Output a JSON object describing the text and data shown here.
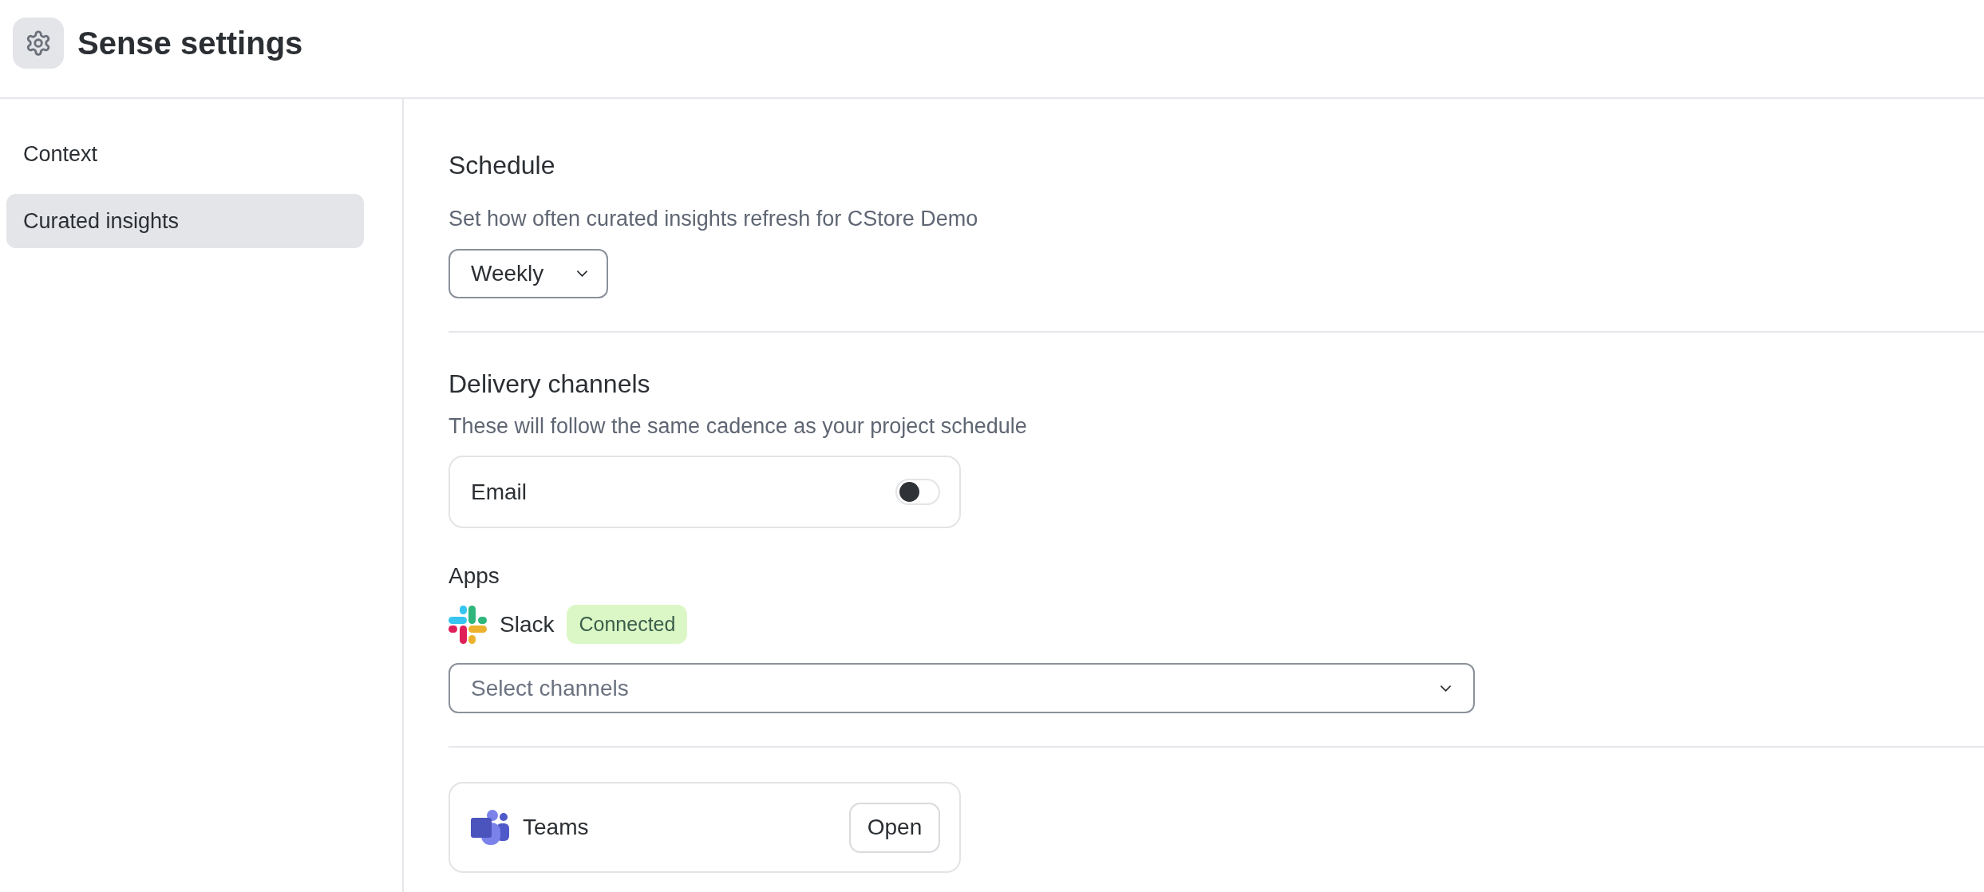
{
  "header": {
    "title": "Sense settings"
  },
  "sidebar": {
    "items": [
      {
        "label": "Context",
        "selected": false
      },
      {
        "label": "Curated insights",
        "selected": true
      }
    ]
  },
  "schedule": {
    "heading": "Schedule",
    "description": "Set how often curated insights refresh for CStore Demo",
    "frequency": {
      "value": "Weekly"
    }
  },
  "delivery": {
    "heading": "Delivery channels",
    "description": "These will follow the same cadence as your project schedule",
    "email": {
      "label": "Email",
      "on": false
    },
    "apps_label": "Apps",
    "slack": {
      "name": "Slack",
      "status": "Connected",
      "channel_select": {
        "placeholder": "Select channels"
      }
    },
    "teams": {
      "name": "Teams",
      "action": "Open"
    }
  }
}
